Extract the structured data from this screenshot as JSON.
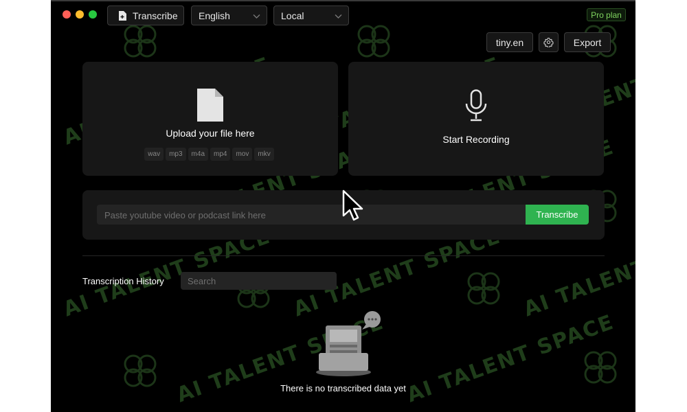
{
  "toolbar": {
    "transcribe_label": "Transcribe",
    "language": "English",
    "engine": "Local",
    "plan_badge": "Pro plan",
    "model": "tiny.en",
    "export_label": "Export"
  },
  "upload": {
    "title": "Upload your file here",
    "formats": [
      "wav",
      "mp3",
      "m4a",
      "mp4",
      "mov",
      "mkv"
    ]
  },
  "record": {
    "title": "Start Recording"
  },
  "link": {
    "placeholder": "Paste youtube video or podcast link here",
    "button": "Transcribe"
  },
  "history": {
    "title": "Transcription History",
    "search_placeholder": "Search",
    "empty_text": "There is no transcribed data yet"
  },
  "watermark": "AI TALENT SPACE",
  "colors": {
    "accent": "#2fb350",
    "badge": "#7fd35f",
    "background": "#000000",
    "card": "#171717"
  }
}
